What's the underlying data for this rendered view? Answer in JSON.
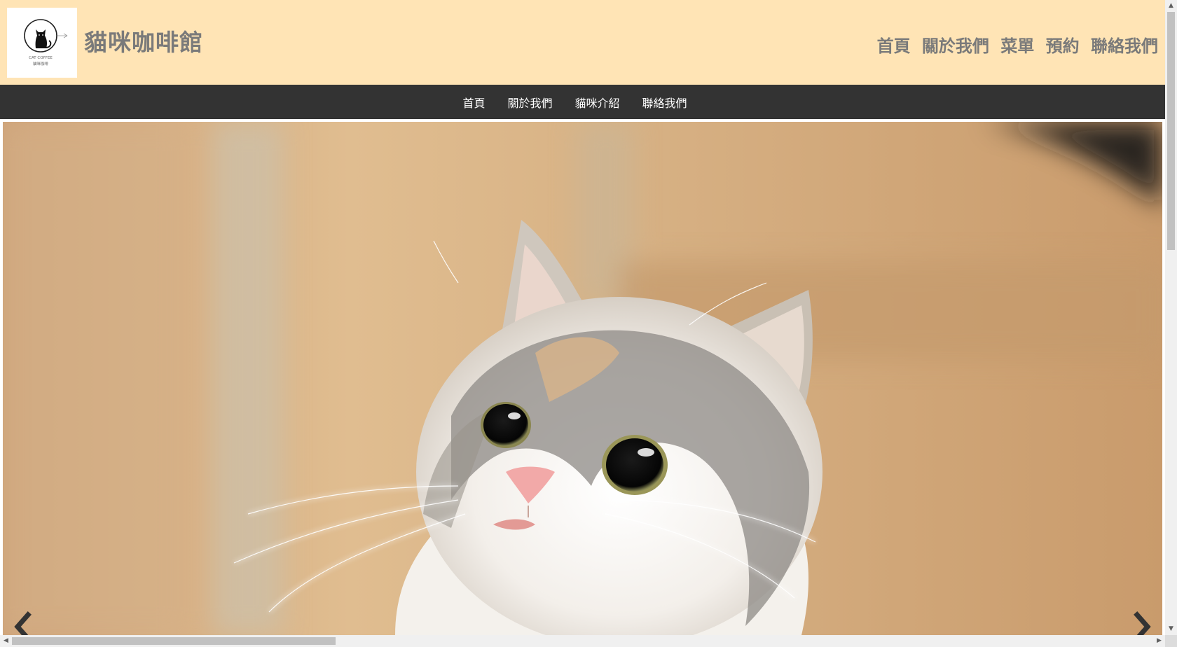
{
  "header": {
    "logo": {
      "icon": "cat-logo-icon",
      "text_line1": "CAT COFFEE",
      "text_line2": "貓咪咖啡"
    },
    "site_title": "貓咪咖啡館",
    "top_links": [
      "首頁",
      "關於我們",
      "菜單",
      "預約",
      "聯絡我們"
    ],
    "background_color": "#ffe4b5",
    "text_color": "#7a7a7a"
  },
  "navbar": {
    "items": [
      "首頁",
      "關於我們",
      "貓咪介紹",
      "聯絡我們"
    ],
    "background_color": "#333333"
  },
  "carousel": {
    "image": "calico-kitten-photo",
    "prev_icon": "chevron-left-icon",
    "next_icon": "chevron-right-icon"
  },
  "scrollbars": {
    "vertical_up_icon": "scroll-up-icon",
    "vertical_down_icon": "scroll-down-icon",
    "horizontal_left_icon": "scroll-left-icon",
    "horizontal_right_icon": "scroll-right-icon"
  }
}
